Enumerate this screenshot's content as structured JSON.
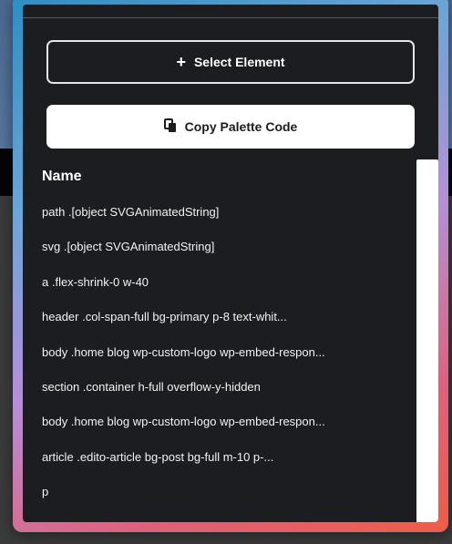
{
  "panel": {
    "select_element_label": "Select Element",
    "copy_palette_label": "Copy Palette Code",
    "list_heading": "Name",
    "items": [
      "path .[object SVGAnimatedString]",
      "svg .[object SVGAnimatedString]",
      "a .flex-shrink-0 w-40",
      "header .col-span-full bg-primary p-8 text-whit...",
      "body .home blog wp-custom-logo wp-embed-respon...",
      "section .container h-full overflow-y-hidden",
      "body .home blog wp-custom-logo wp-embed-respon...",
      "article .edito-article bg-post bg-full m-10 p-...",
      "p"
    ]
  },
  "icons": {
    "select": "plus-icon",
    "copy": "copy-icon"
  },
  "colors": {
    "panel_bg": "#1c1d20",
    "frame_gradient_start": "#2d8ec2",
    "frame_gradient_end": "#ef5c46",
    "page_header": "#5777a0"
  }
}
